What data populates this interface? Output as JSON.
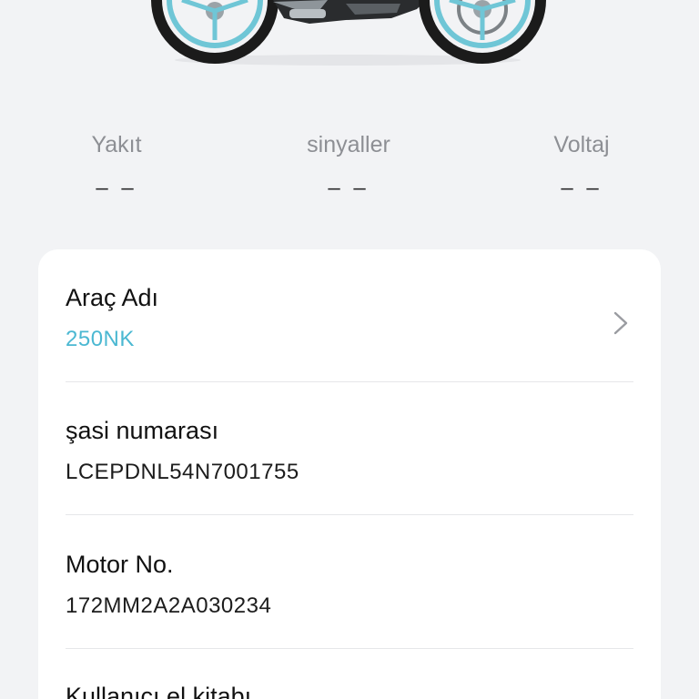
{
  "stats": {
    "fuel": {
      "label": "Yakıt",
      "value": "– –"
    },
    "signals": {
      "label": "sinyaller",
      "value": "– –"
    },
    "voltage": {
      "label": "Voltaj",
      "value": "– –"
    }
  },
  "vehicle": {
    "name_label": "Araç Adı",
    "name_value": "250NK",
    "chassis_label": "şasi numarası",
    "chassis_value": "LCEPDNL54N7001755",
    "motor_label": "Motor No.",
    "motor_value": "172MM2A2A030234",
    "manual_label": "Kullanıcı el kitabı"
  },
  "colors": {
    "accent": "#4bb8d2",
    "background": "#f2f3f5",
    "card": "#ffffff",
    "wheel": "#6fc6d6"
  },
  "icons": {
    "chevron": "chevron-right-icon",
    "image": "motorcycle-image"
  }
}
